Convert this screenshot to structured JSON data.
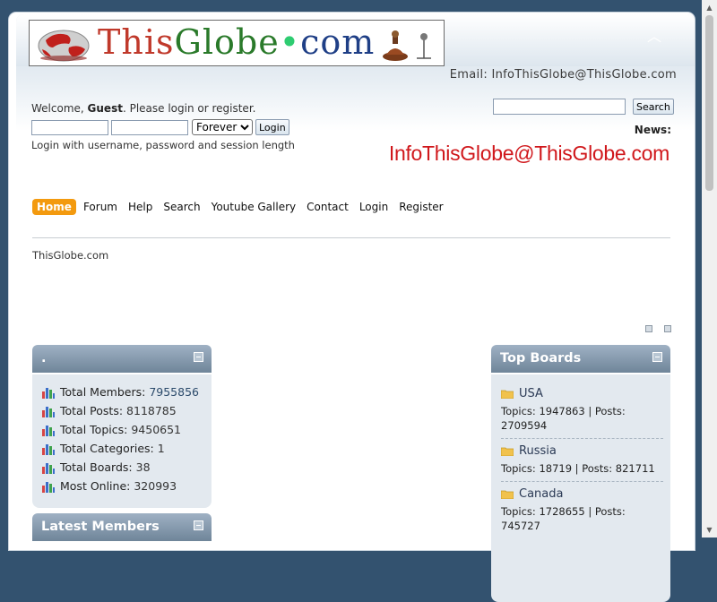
{
  "logo": {
    "parts": [
      "This",
      "Globe",
      ".com"
    ]
  },
  "header": {
    "email_line": "Email: InfoThisGlobe@ThisGlobe.com"
  },
  "welcome": {
    "prefix": "Welcome, ",
    "user": "Guest",
    "suffix": ". Please login or register."
  },
  "login": {
    "session_selected": "Forever",
    "button_label": "Login",
    "hint": "Login with username, password and session length"
  },
  "search": {
    "button_label": "Search"
  },
  "news": {
    "label": "News:",
    "text": "InfoThisGlobe@ThisGlobe.com"
  },
  "menu": {
    "items": [
      {
        "label": "Home"
      },
      {
        "label": "Forum"
      },
      {
        "label": "Help"
      },
      {
        "label": "Search"
      },
      {
        "label": "Youtube Gallery"
      },
      {
        "label": "Contact"
      },
      {
        "label": "Login"
      },
      {
        "label": "Register"
      }
    ]
  },
  "breadcrumb": "ThisGlobe.com",
  "stats_panel": {
    "title": ".",
    "rows": [
      {
        "label": "Total Members:",
        "value": "7955856"
      },
      {
        "label": "Total Posts:",
        "value": "8118785"
      },
      {
        "label": "Total Topics:",
        "value": "9450651"
      },
      {
        "label": "Total Categories:",
        "value": "1"
      },
      {
        "label": "Total Boards:",
        "value": "38"
      },
      {
        "label": "Most Online:",
        "value": "320993"
      }
    ]
  },
  "latest_members": {
    "title": "Latest Members"
  },
  "top_boards": {
    "title": "Top Boards",
    "boards": [
      {
        "name": "USA",
        "stats": "Topics: 1947863 | Posts: 2709594"
      },
      {
        "name": "Russia",
        "stats": "Topics: 18719 | Posts: 821711"
      },
      {
        "name": "Canada",
        "stats": "Topics: 1728655 | Posts: 745727"
      }
    ]
  },
  "colors": {
    "page_background": "#33526f",
    "menu_active": "#f39a0f",
    "news_text": "#d0171b",
    "panel_header": "#6f8599"
  }
}
